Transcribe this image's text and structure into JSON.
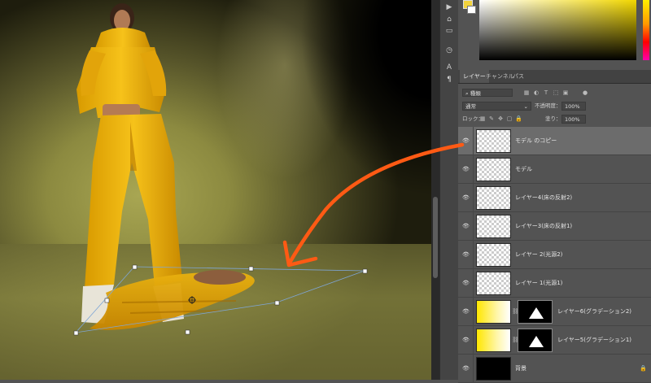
{
  "tabs": [
    {
      "label": "レイヤー",
      "active": true
    },
    {
      "label": "チャンネル",
      "active": false
    },
    {
      "label": "パス",
      "active": false
    }
  ],
  "options": {
    "blend_mode": "通常",
    "opacity_label": "不透明度：",
    "opacity_value": "100%",
    "lock_label": "ロック：",
    "fill_label": "塗り：",
    "fill_value": "100%"
  },
  "filter": {
    "kind": "種類"
  },
  "colors": {
    "foreground": "#f3d33c",
    "background": "#ffffff",
    "arrow": "#ff5a14",
    "bbox": "#7fa6d6"
  },
  "layers": [
    {
      "name": "モデル のコピー",
      "thumb": "transparent",
      "selected": true,
      "visible": true
    },
    {
      "name": "モデル",
      "thumb": "transparent",
      "selected": false,
      "visible": true
    },
    {
      "name": "レイヤー4(床の反射2)",
      "thumb": "transparent",
      "selected": false,
      "visible": true
    },
    {
      "name": "レイヤー3(床の反射1)",
      "thumb": "transparent",
      "selected": false,
      "visible": true
    },
    {
      "name": "レイヤー 2(光源2)",
      "thumb": "transparent",
      "selected": false,
      "visible": true
    },
    {
      "name": "レイヤー 1(光源1)",
      "thumb": "transparent",
      "selected": false,
      "visible": true
    },
    {
      "name": "レイヤー6(グラデーション2)",
      "thumb": "gradient",
      "mask": true,
      "selected": false,
      "visible": true
    },
    {
      "name": "レイヤー5(グラデーション1)",
      "thumb": "gradient",
      "mask": true,
      "selected": false,
      "visible": true
    },
    {
      "name": "背景",
      "thumb": "black",
      "locked": true,
      "selected": false,
      "visible": true
    }
  ],
  "icons": {
    "eye": "eye-icon",
    "lock": "lock-icon",
    "chain": "link-icon"
  }
}
